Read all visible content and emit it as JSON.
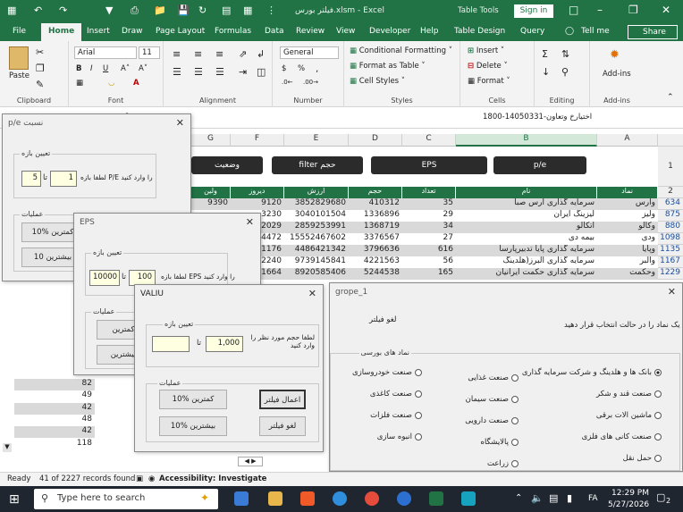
{
  "window": {
    "title": "فیلتر بورس.xlsm - Excel",
    "table_tools": "Table Tools",
    "sign_in": "Sign in"
  },
  "tabs": [
    "File",
    "Home",
    "Insert",
    "Draw",
    "Page Layout",
    "Formulas",
    "Data",
    "Review",
    "View",
    "Developer",
    "Help",
    "Table Design",
    "Query"
  ],
  "tell_me": "Tell me",
  "share": "Share",
  "ribbon": {
    "paste": "Paste",
    "clipboard": "Clipboard",
    "font_name": "Arial",
    "font_size": "11",
    "font": "Font",
    "alignment": "Alignment",
    "number_format": "General",
    "number": "Number",
    "cond_format": "Conditional Formatting",
    "format_table": "Format as Table",
    "cell_styles": "Cell Styles",
    "styles": "Styles",
    "insert": "Insert",
    "delete": "Delete",
    "format": "Format",
    "cells": "Cells",
    "editing": "Editing",
    "addins": "Add-ins",
    "addins_group": "Add-ins"
  },
  "formula_bar": {
    "value": "1800-14050331-اختیارخ وتعاون"
  },
  "columns": [
    "G",
    "F",
    "E",
    "D",
    "C",
    "B",
    "A"
  ],
  "buttons": {
    "status": "وضعیت",
    "volume": "filter حجم",
    "eps": "EPS",
    "pe": "p/e"
  },
  "table_headers": [
    "ارزش",
    "حجم",
    "تعداد",
    "نام",
    "نماد"
  ],
  "table_headers_left": [
    "ولین",
    "دیروز"
  ],
  "rows": [
    {
      "g": "9390",
      "f": "9120",
      "e": "3852829680",
      "d": "410312",
      "c": "35",
      "b": "سرمایه گذاری ارس صبا",
      "a": "وارس",
      "n": "634"
    },
    {
      "g": "",
      "f": "3230",
      "e": "3040101504",
      "d": "1336896",
      "c": "29",
      "b": "لیزینگ ایران",
      "a": "ولیز",
      "n": "875"
    },
    {
      "g": "",
      "f": "2029",
      "e": "2859253991",
      "d": "1368719",
      "c": "34",
      "b": "اتکالو",
      "a": "وکالو",
      "n": "880"
    },
    {
      "g": "",
      "f": "4472",
      "e": "15552467602",
      "d": "3376567",
      "c": "27",
      "b": "بیمه دی",
      "a": "ودی",
      "n": "1098"
    },
    {
      "g": "",
      "f": "1176",
      "e": "4486421342",
      "d": "3796636",
      "c": "616",
      "b": "سرمایه گذاری پایا تدبیرپارسا",
      "a": "وپایا",
      "n": "1135"
    },
    {
      "g": "",
      "f": "2240",
      "e": "9739145841",
      "d": "4221563",
      "c": "56",
      "b": "سرمایه گذاری البرز(هلدینگ",
      "a": "والبر",
      "n": "1167"
    },
    {
      "g": "",
      "f": "1664",
      "e": "8920585406",
      "d": "5244538",
      "c": "165",
      "b": "سرمایه گذاری حکمت ایرانیان",
      "a": "وحکمت",
      "n": "1229"
    }
  ],
  "left_col_values": [
    "82",
    "49",
    "42",
    "48",
    "42",
    "118"
  ],
  "pe_dialog": {
    "title": "p/e نسبت",
    "range": "تعیین بازه",
    "prompt": "لطفا بازه P/E را وارد کنید",
    "from": "1",
    "to": "5",
    "ta": "تا",
    "ops": "عملیات",
    "lowest": "10% کمترین",
    "highest": "10 بیشترین"
  },
  "eps_dialog": {
    "title": "EPS",
    "range": "تعیین بازه",
    "prompt": "لطفا بازه EPS را وارد کنید",
    "from": "100",
    "to": "10000",
    "ta": "تا",
    "ops": "عملیات",
    "lowest": "کمترین",
    "highest": "بیشترین"
  },
  "valu_dialog": {
    "title": "VALIU",
    "range": "تعیین بازه",
    "prompt": "لطفا حجم مورد نظر را وارد کنید",
    "from": "1,000",
    "to": "",
    "ta": "تا",
    "ops": "عملیات",
    "apply": "اعمال فیلتر",
    "lowest": "10% کمترین",
    "highest": "10% بیشترین",
    "cancel": "لغو فیلتر"
  },
  "grope_dialog": {
    "title": "grope_1",
    "instr": "یک نماد را در حالت انتخاب قرار دهید",
    "cancel": "لغو فیلتر",
    "frame": "نماد های بورسی",
    "options": [
      {
        "label": "بانک ها و هلدینگ و شرکت سرمایه گذاری",
        "on": true
      },
      {
        "label": "صنعت غذایی",
        "on": false
      },
      {
        "label": "صنعت خودروسازی",
        "on": false
      },
      {
        "label": "صنعت قند و شکر",
        "on": false
      },
      {
        "label": "صنعت سیمان",
        "on": false
      },
      {
        "label": "صنعت کاغذی",
        "on": false
      },
      {
        "label": "ماشین الات برقی",
        "on": false
      },
      {
        "label": "صنعت دارویی",
        "on": false
      },
      {
        "label": "صنعت فلزات",
        "on": false
      },
      {
        "label": "صنعت کانی های فلزی",
        "on": false
      },
      {
        "label": "پالایشگاه",
        "on": false
      },
      {
        "label": "انبوه سازی",
        "on": false
      },
      {
        "label": "حمل نقل",
        "on": false
      },
      {
        "label": "زراعت",
        "on": false
      }
    ]
  },
  "status_bar": {
    "ready": "Ready",
    "records": "41 of 2227 records found",
    "accessibility": "Accessibility: Investigate"
  },
  "taskbar": {
    "search": "Type here to search",
    "lang": "FA",
    "time": "12:29 PM",
    "date": "5/27/2026",
    "notif": "2"
  },
  "colors": {
    "excel_green": "#217346",
    "taskbar": "#1f2630",
    "textbox": "#ffffe1"
  }
}
